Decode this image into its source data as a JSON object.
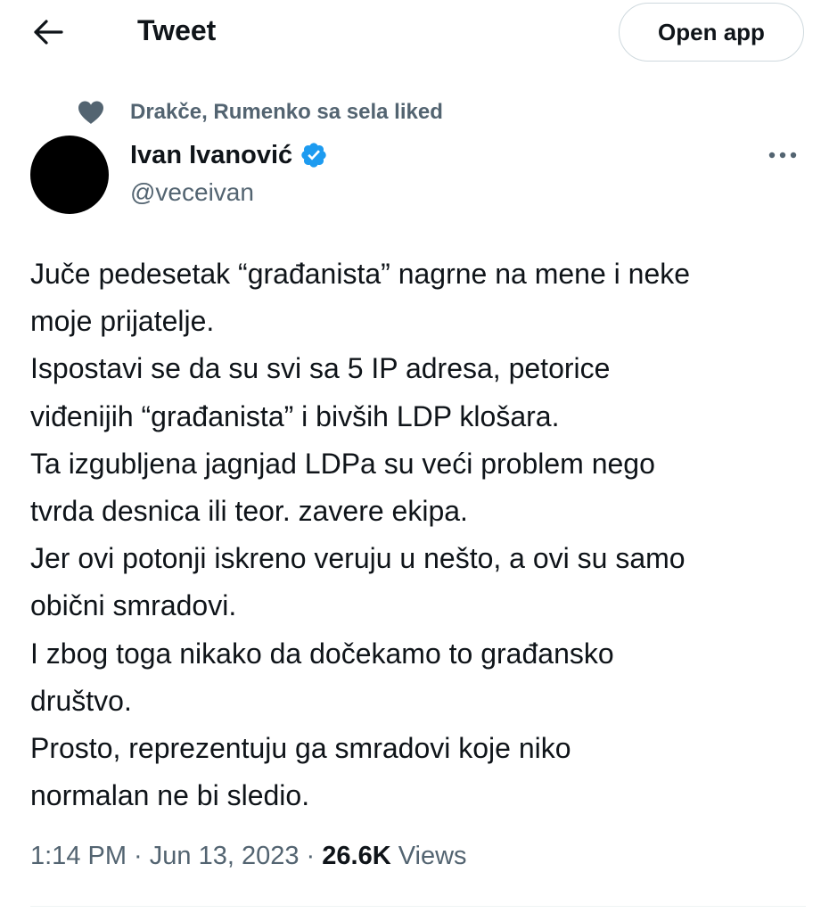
{
  "header": {
    "back_icon": "arrow-left-icon",
    "title": "Tweet",
    "open_app_label": "Open app"
  },
  "social_context": {
    "icon": "heart-icon",
    "text": "Drakče, Rumenko sa sela liked"
  },
  "author": {
    "display_name": "Ivan Ivanović",
    "verified_icon": "verified-badge-icon",
    "handle": "@veceivan"
  },
  "more_icon": "more-horizontal-icon",
  "tweet": {
    "lines": [
      "Juče pedesetak “građanista” nagrne na mene i neke",
      "moje prijatelje.",
      "Ispostavi se da su svi sa 5 IP adresa, petorice",
      "viđenijih “građanista” i bivših LDP klošara.",
      "Ta izgubljena jagnjad LDPa su veći problem nego",
      "tvrda desnica ili teor. zavere ekipa.",
      "Jer ovi potonji iskreno veruju u nešto, a ovi su samo",
      "obični smradovi.",
      "I zbog toga nikako da dočekamo to građansko",
      "društvo.",
      "Prosto, reprezentuju ga smradovi koje niko",
      "normalan ne bi sledio."
    ]
  },
  "meta": {
    "time": "1:14 PM",
    "separator": " · ",
    "date": "Jun 13, 2023",
    "views_count": "26.6K",
    "views_label": "Views"
  },
  "colors": {
    "text_primary": "#0f1419",
    "text_secondary": "#536471",
    "verified_blue": "#1d9bf0",
    "border": "#cfd9de"
  }
}
